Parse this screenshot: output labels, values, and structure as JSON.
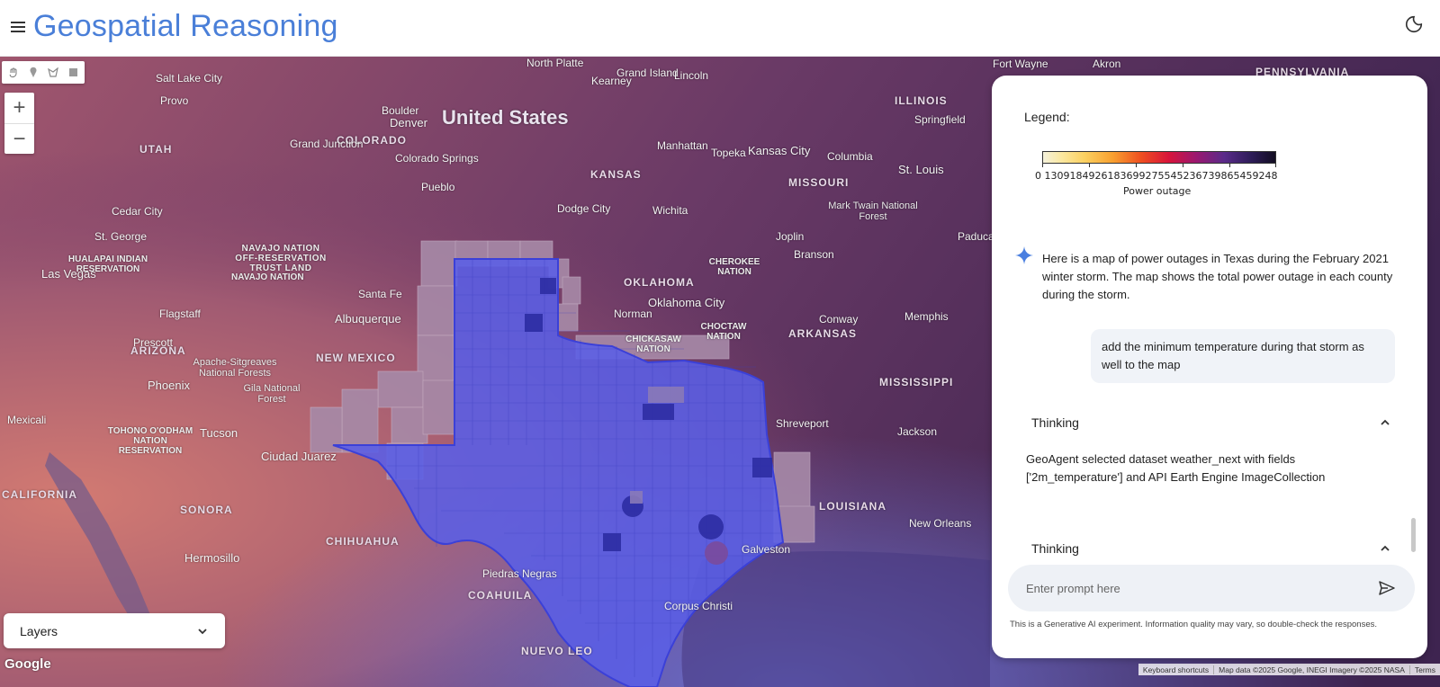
{
  "header": {
    "title": "Geospatial Reasoning",
    "menu_icon": "hamburger-menu-icon",
    "theme_icon": "dark-mode-moon-icon"
  },
  "map": {
    "country_label": "United States",
    "state_labels": [
      "UTAH",
      "COLORADO",
      "KANSAS",
      "MISSOURI",
      "ILLINOIS",
      "OKLAHOMA",
      "ARKANSAS",
      "NEW MEXICO",
      "ARIZONA",
      "MISSISSIPPI",
      "LOUISIANA",
      "SONORA",
      "CHIHUAHUA",
      "COAHUILA",
      "NUEVO LEO",
      "PENNSYLVANIA",
      "CALIFORNIA"
    ],
    "city_labels": [
      "Salt Lake City",
      "Provo",
      "Denver",
      "Boulder",
      "Kansas City",
      "Topeka",
      "St. Louis",
      "Columbia",
      "Springfield",
      "Las Vegas",
      "St. George",
      "Cedar City",
      "Albuquerque",
      "Santa Fe",
      "Flagstaff",
      "Prescott",
      "Phoenix",
      "Tucson",
      "Mexicali",
      "Ciudad Juarez",
      "Hermosillo",
      "Oklahoma City",
      "Memphis",
      "Jackson",
      "Shreveport",
      "New Orleans",
      "Galveston",
      "Wichita",
      "Joplin",
      "Branson",
      "Paducah",
      "Conway",
      "Grand Island",
      "Kearney",
      "Lincoln",
      "North Platte",
      "Akron",
      "Fort Wayne",
      "Dodge City",
      "Grand Junction",
      "Colorado Springs",
      "Pueblo",
      "Manhattan",
      "Norman",
      "Corpus Christi",
      "Piedras Negras"
    ],
    "region_labels": [
      "NAVAJO NATION OFF-RESERVATION TRUST LAND",
      "NAVAJO NATION",
      "HUALAPAI INDIAN RESERVATION",
      "TOHONO O'ODHAM NATION RESERVATION",
      "Apache-Sitgreaves National Forests",
      "Gila National Forest",
      "Mark Twain National Forest",
      "CHEROKEE NATION",
      "CHICKASAW NATION",
      "CHOCTAW NATION"
    ],
    "draw_tools": [
      "hand-pan-icon",
      "marker-pin-icon",
      "polygon-icon",
      "rectangle-icon"
    ],
    "zoom_in": "+",
    "zoom_out": "−",
    "layers_label": "Layers",
    "google_logo": "Google",
    "attribution": [
      "Keyboard shortcuts",
      "Map data ©2025 Google, INEGI Imagery ©2025 NASA",
      "Terms"
    ],
    "overlay_color": "#5a5fe6",
    "overlay_dark_color": "#2a2aa0"
  },
  "panel": {
    "legend_title": "Legend:",
    "legend_ticklabels": "0    13091849261836992755452367398545 9248",
    "legend_ticklabels_raw": "0   1309184926183699275545236739865459248",
    "legend_axis": "Power outage",
    "ai_message": "Here is a map of power outages in Texas during the February 2021 winter storm. The map shows the total power outage in each county during the storm.",
    "user_message": "add the minimum temperature during that storm as well to the map",
    "thinking_label_1": "Thinking",
    "thinking_text_1": "GeoAgent selected dataset weather_next with fields ['2m_temperature'] and API Earth Engine ImageCollection",
    "thinking_label_2": "Thinking",
    "prompt_placeholder": "Enter prompt here",
    "disclaimer": "This is a Generative AI experiment. Information quality may vary, so double-check the responses."
  }
}
